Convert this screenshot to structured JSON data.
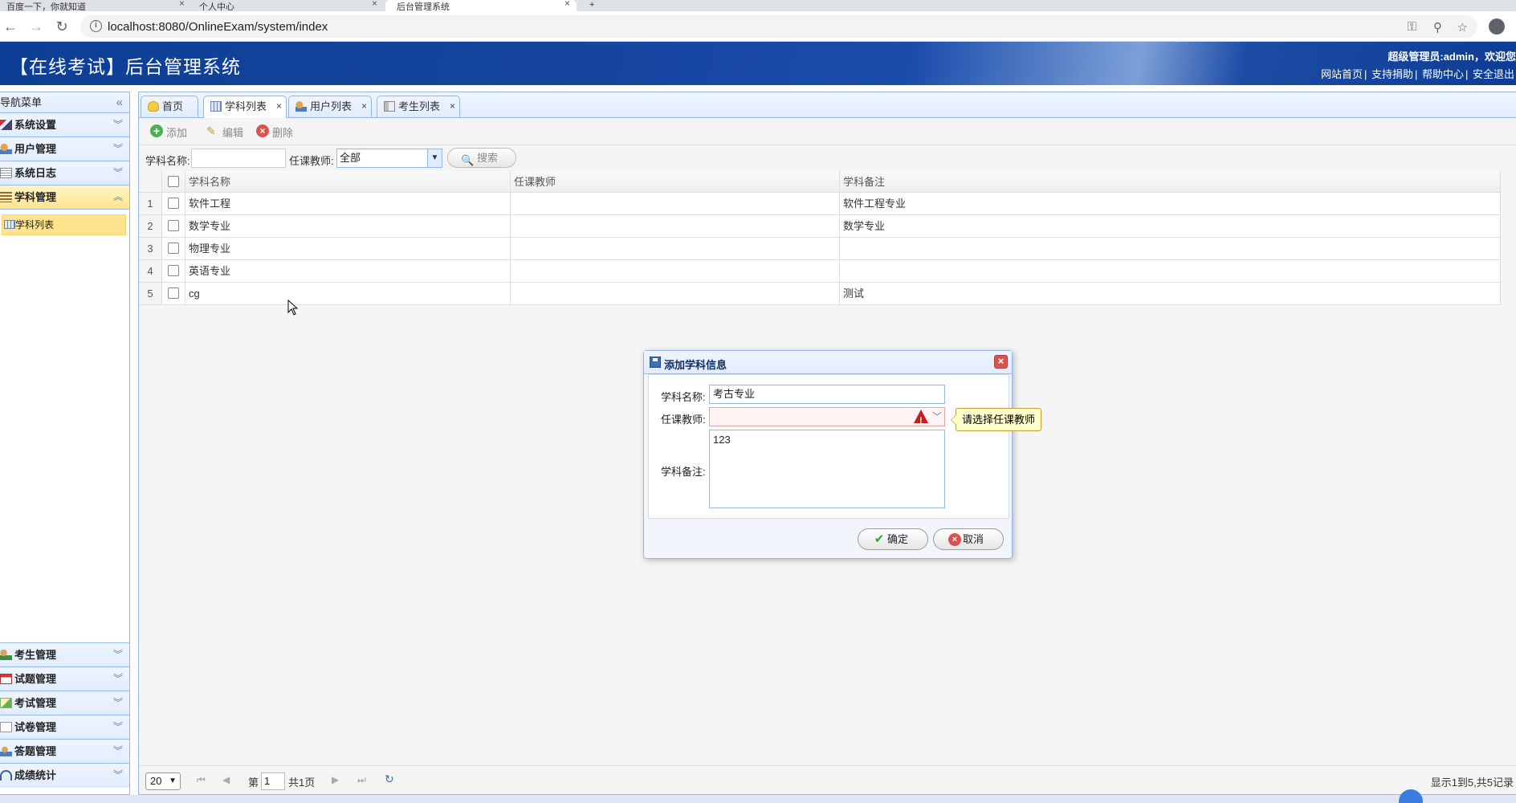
{
  "browser": {
    "tabs": [
      {
        "label": "百度一下，你就知道"
      },
      {
        "label": "个人中心"
      },
      {
        "label": "后台管理系统"
      },
      {
        "label": "+"
      }
    ],
    "url": "localhost:8080/OnlineExam/system/index"
  },
  "header": {
    "title": "【在线考试】后台管理系统",
    "user_text": "超级管理员:admin，欢迎您",
    "links": [
      "网站首页",
      "支持捐助",
      "帮助中心",
      "安全退出"
    ]
  },
  "sidebar": {
    "title": "导航菜单",
    "collapse_glyph": "«",
    "top_items": [
      {
        "label": "系统设置"
      },
      {
        "label": "用户管理"
      },
      {
        "label": "系统日志"
      },
      {
        "label": "学科管理"
      }
    ],
    "sub_item": "学科列表",
    "bottom_items": [
      {
        "label": "考生管理"
      },
      {
        "label": "试题管理"
      },
      {
        "label": "考试管理"
      },
      {
        "label": "试卷管理"
      },
      {
        "label": "答题管理"
      },
      {
        "label": "成绩统计"
      }
    ]
  },
  "page_tabs": [
    {
      "label": "首页"
    },
    {
      "label": "学科列表"
    },
    {
      "label": "用户列表"
    },
    {
      "label": "考生列表"
    }
  ],
  "toolbar": {
    "add": "添加",
    "edit": "编辑",
    "delete": "删除"
  },
  "search": {
    "name_label": "学科名称:",
    "name_value": "",
    "teacher_label": "任课教师:",
    "teacher_value": "全部",
    "button": "搜索"
  },
  "table": {
    "columns": [
      "学科名称",
      "任课教师",
      "学科备注"
    ],
    "rows": [
      {
        "num": "1",
        "name": "软件工程",
        "teacher": "",
        "remark": "软件工程专业"
      },
      {
        "num": "2",
        "name": "数学专业",
        "teacher": "",
        "remark": "数学专业"
      },
      {
        "num": "3",
        "name": "物理专业",
        "teacher": "",
        "remark": ""
      },
      {
        "num": "4",
        "name": "英语专业",
        "teacher": "",
        "remark": ""
      },
      {
        "num": "5",
        "name": "cg",
        "teacher": "",
        "remark": "测试"
      }
    ]
  },
  "pager": {
    "page_size": "20",
    "page_prefix": "第",
    "page_value": "1",
    "page_total": "共1页",
    "info": "显示1到5,共5记录"
  },
  "dialog": {
    "title": "添加学科信息",
    "name_label": "学科名称:",
    "name_value": "考古专业",
    "teacher_label": "任课教师:",
    "teacher_value": "",
    "remark_label": "学科备注:",
    "remark_value": "123",
    "tooltip": "请选择任课教师",
    "ok": "确定",
    "cancel": "取消"
  }
}
